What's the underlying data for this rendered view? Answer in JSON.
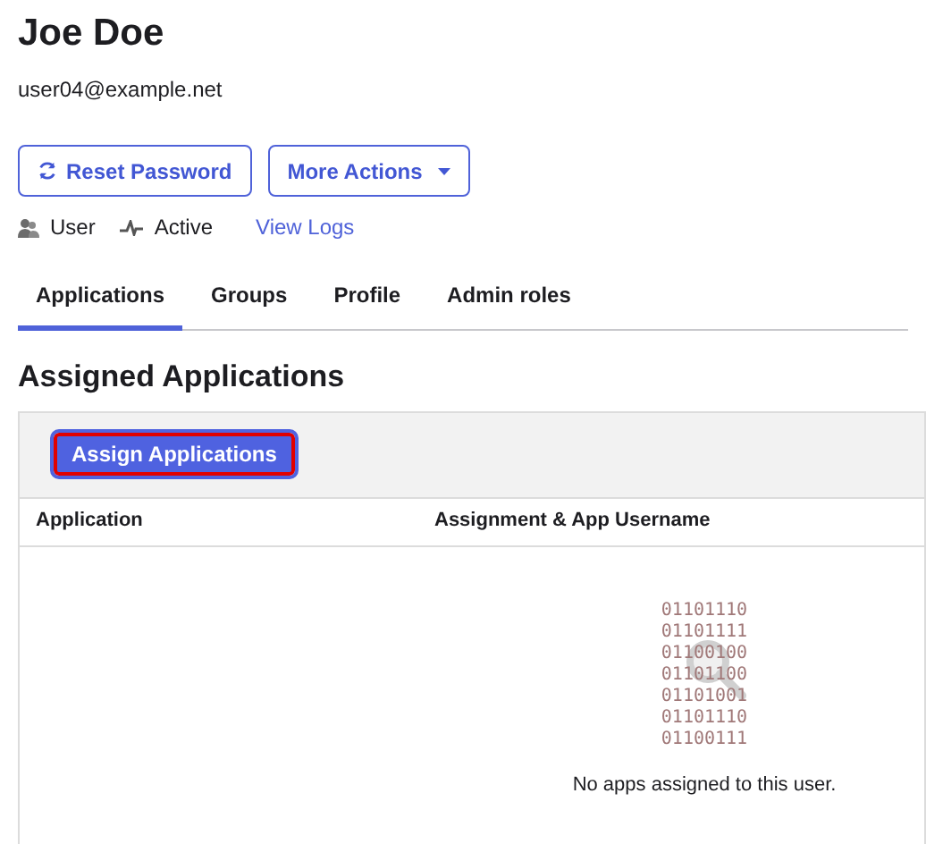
{
  "user": {
    "name": "Joe Doe",
    "email": "user04@example.net"
  },
  "actions": [
    {
      "label": "Reset Password",
      "kind": "reset"
    },
    {
      "label": "More Actions",
      "kind": "dropdown"
    }
  ],
  "meta": [
    {
      "label": "User",
      "kind": "user"
    },
    {
      "label": "Active",
      "kind": "status"
    },
    {
      "label": "View Logs",
      "kind": "link"
    }
  ],
  "tabs": [
    {
      "label": "Applications",
      "selected": true
    },
    {
      "label": "Groups",
      "selected": false
    },
    {
      "label": "Profile",
      "selected": false
    },
    {
      "label": "Admin roles",
      "selected": false
    }
  ],
  "section_title": "Assigned Applications",
  "assign_button": "Assign Applications",
  "table": {
    "columns": [
      "Application",
      "Assignment & App Username"
    ]
  },
  "empty_state": {
    "binary_lines": [
      "01101110",
      "01101111",
      "01100100",
      "01101100",
      "01101001",
      "01101110",
      "01100111"
    ],
    "message": "No apps assigned to this user."
  }
}
